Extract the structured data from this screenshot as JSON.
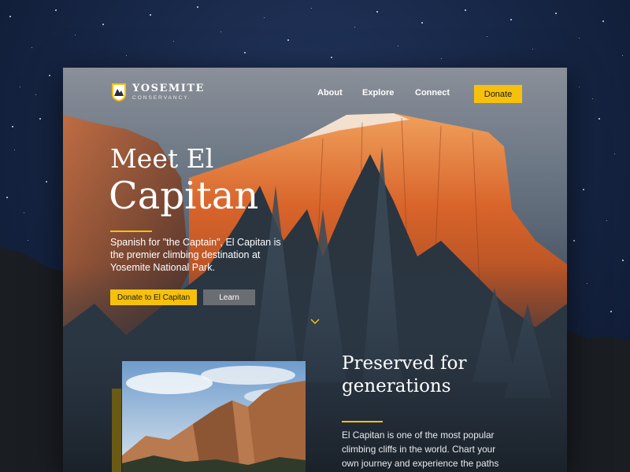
{
  "brand": {
    "name": "YOSEMITE",
    "sub": "CONSERVANCY."
  },
  "nav": {
    "links": [
      "About",
      "Explore",
      "Connect"
    ],
    "donate_label": "Donate"
  },
  "hero": {
    "title_line1": "Meet El",
    "title_line2": "Capitan",
    "description": "Spanish for \"the Captain\", El Capitan is the premier climbing destination at Yosemite National Park.",
    "primary_button": "Donate to El Capitan",
    "secondary_button": "Learn"
  },
  "section": {
    "title": "Preserved for generations",
    "body": "El Capitan is one of the most popular climbing cliffs in the world. Chart your own journey and experience the paths"
  },
  "colors": {
    "accent": "#f6c10d",
    "background": "#162544"
  },
  "icons": {
    "logo": "yosemite-badge-icon",
    "scroll": "chevron-down-icon"
  }
}
